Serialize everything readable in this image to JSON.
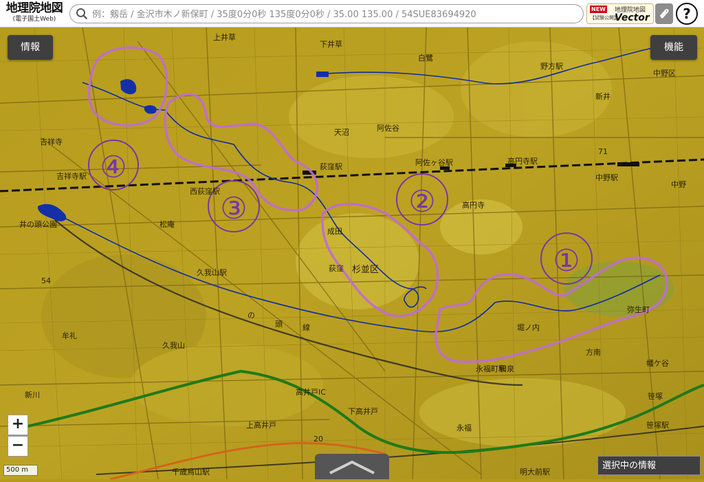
{
  "app": {
    "logo_title": "地理院地図",
    "logo_sub": "(電子国土Web)"
  },
  "search": {
    "placeholder": "例：剱岳 / 金沢市木ノ新保町 / 35度0分0秒 135度0分0秒 / 35.00 135.00 / 54SUE83694920"
  },
  "header": {
    "vector_new": "NEW",
    "vector_top": "地理院地図",
    "vector_exp": "【試験公開】",
    "vector_label": "Vector",
    "help_label": "?"
  },
  "buttons": {
    "info": "情報",
    "function": "機能",
    "zoom_in": "+",
    "zoom_out": "−",
    "selected_info": "選択中の情報"
  },
  "scale_bar": "500 m",
  "map": {
    "colors": {
      "terrain": "#b59a1c",
      "terrain_low": "#9c8a22",
      "highlight": "#d7c84a",
      "annotation": "#c06bd6",
      "number": "#7a35a8",
      "river": "#1030a0",
      "green_line": "#1e7a1a",
      "orange_line": "#d4641a",
      "railway": "#1a1a1a",
      "roads": "#6e5c15"
    },
    "annotation_numbers": [
      "①",
      "②",
      "③",
      "④"
    ],
    "labels": [
      "上井草",
      "下井草",
      "白鷺",
      "野方駅",
      "中野区",
      "新井",
      "吉祥寺",
      "吉祥寺駅",
      "天沼",
      "阿佐谷",
      "阿佐ヶ谷駅",
      "高円寺駅",
      "荻窪駅",
      "西荻窪駅",
      "中野駅",
      "中野",
      "高円寺",
      "井の頭公園",
      "松庵",
      "成田",
      "荻窪",
      "杉並区",
      "久我山駅",
      "久我山",
      "の",
      "頭",
      "線",
      "堀ノ内",
      "弥生町",
      "和泉",
      "永福町駅",
      "方南",
      "牟礼",
      "新川",
      "高井戸IC",
      "下高井戸",
      "上高井戸",
      "永福",
      "笹塚",
      "笹塚駅",
      "幡ケ谷",
      "千歳烏山駅",
      "明大前駅",
      "54",
      "71",
      "20"
    ]
  }
}
